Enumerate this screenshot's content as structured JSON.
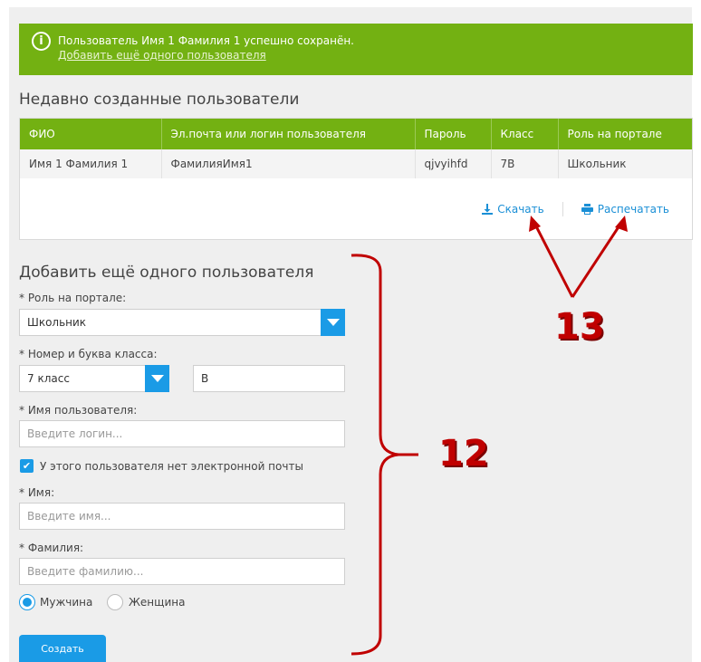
{
  "notice": {
    "message": "Пользователь Имя 1 Фамилия 1 успешно сохранён.",
    "link": "Добавить ещё одного пользователя",
    "icon": "info-icon"
  },
  "recent": {
    "title": "Недавно созданные пользователи",
    "columns": [
      "ФИО",
      "Эл.почта или логин пользователя",
      "Пароль",
      "Класс",
      "Роль на портале"
    ],
    "rows": [
      [
        "Имя 1 Фамилия 1",
        "ФамилияИмя1",
        "qjvyihfd",
        "7В",
        "Школьник"
      ]
    ],
    "download_label": "Скачать",
    "print_label": "Распечатать"
  },
  "form": {
    "title": "Добавить ещё одного пользователя",
    "role_label": "* Роль на портале:",
    "role_value": "Школьник",
    "class_label": "* Номер и буква класса:",
    "class_number": "7 класс",
    "class_letter": "В",
    "username_label": "* Имя пользователя:",
    "username_placeholder": "Введите логин...",
    "no_email_label": "У этого пользователя нет электронной почты",
    "first_name_label": "* Имя:",
    "first_name_placeholder": "Введите имя...",
    "last_name_label": "* Фамилия:",
    "last_name_placeholder": "Введите фамилию...",
    "gender_male": "Мужчина",
    "gender_female": "Женщина",
    "submit_label": "Создать"
  },
  "annotations": {
    "label_12": "12",
    "label_13": "13",
    "color": "#c00000"
  },
  "colors": {
    "accent_green": "#73b112",
    "accent_blue": "#1a9be6"
  }
}
